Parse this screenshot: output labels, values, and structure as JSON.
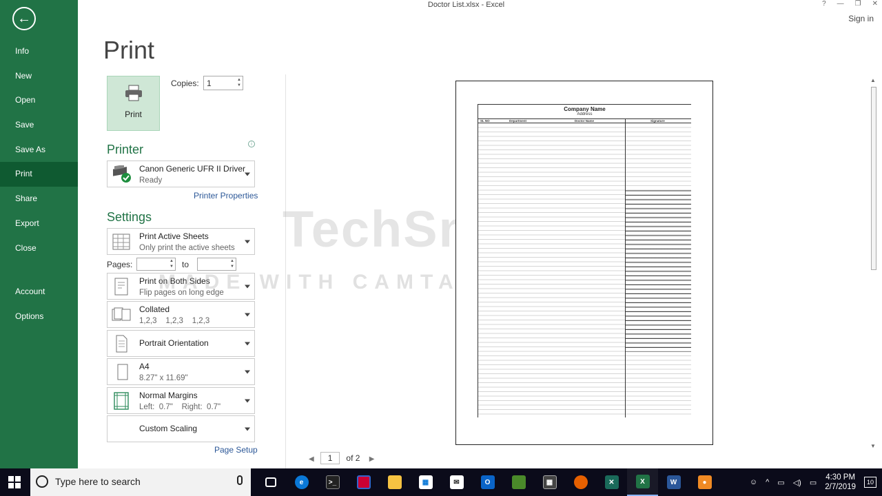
{
  "window": {
    "title": "Doctor List.xlsx - Excel",
    "sign_in": "Sign in",
    "help": "?",
    "minimize": "—",
    "restore": "❐",
    "close": "✕"
  },
  "sidebar": {
    "items": [
      {
        "label": "Info"
      },
      {
        "label": "New"
      },
      {
        "label": "Open"
      },
      {
        "label": "Save"
      },
      {
        "label": "Save As"
      },
      {
        "label": "Print",
        "active": true
      },
      {
        "label": "Share"
      },
      {
        "label": "Export"
      },
      {
        "label": "Close"
      },
      {
        "label": "Account"
      },
      {
        "label": "Options"
      }
    ]
  },
  "print_panel": {
    "title": "Print",
    "print_button": "Print",
    "copies_label": "Copies:",
    "copies_value": "1",
    "printer_heading": "Printer",
    "printer_name": "Canon Generic UFR II Driver",
    "printer_status": "Ready",
    "printer_properties": "Printer Properties",
    "settings_heading": "Settings",
    "what": {
      "title": "Print Active Sheets",
      "sub": "Only print the active sheets"
    },
    "pages_label": "Pages:",
    "pages_to": "to",
    "sides": {
      "title": "Print on Both Sides",
      "sub": "Flip pages on long edge"
    },
    "collation": {
      "title": "Collated",
      "sub": "1,2,3    1,2,3    1,2,3"
    },
    "orientation": {
      "title": "Portrait Orientation"
    },
    "paper": {
      "title": "A4",
      "sub": "8.27\" x 11.69\""
    },
    "margins": {
      "title": "Normal Margins",
      "sub": "Left:  0.7\"    Right:  0.7\""
    },
    "scaling": {
      "title": "Custom Scaling"
    },
    "page_setup": "Page Setup"
  },
  "preview": {
    "company_name": "Company Name",
    "address": "Address",
    "col_sl": "SL NO",
    "col_dept": "Department",
    "col_doctor": "Doctor Name",
    "col_sign": "Signature",
    "current_page": "1",
    "of_pages": "of 2"
  },
  "watermark": {
    "line1": "TechSmith",
    "line2": "MADE WITH CAMTASIA FREE TRIAL"
  },
  "taskbar": {
    "search_placeholder": "Type here to search",
    "time": "4:30 PM",
    "date": "2/7/2019",
    "notifications": "10"
  }
}
